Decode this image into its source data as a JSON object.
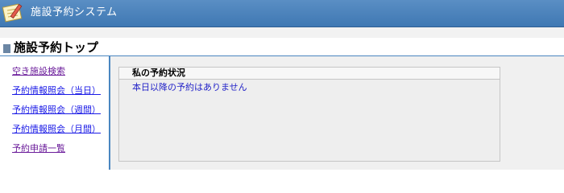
{
  "header": {
    "app_title": "施設予約システム",
    "logo_icon": "notepad-pencil-icon"
  },
  "page": {
    "title": "施設予約トップ"
  },
  "sidebar": {
    "items": [
      {
        "label": "空き施設検索",
        "state": "visited"
      },
      {
        "label": "予約情報照会（当日）",
        "state": "unvisited"
      },
      {
        "label": "予約情報照会（週間）",
        "state": "unvisited"
      },
      {
        "label": "予約情報照会（月間）",
        "state": "unvisited"
      },
      {
        "label": "予約申請一覧",
        "state": "visited"
      }
    ]
  },
  "my_reservations": {
    "title": "私の予約状況",
    "message": "本日以降の予約はありません"
  },
  "colors": {
    "header_bg": "#4a82bd",
    "accent_border": "#4a86c0",
    "link_unvisited": "#1a1ae6",
    "link_visited": "#6a1b9a",
    "message_text": "#2323c8"
  }
}
